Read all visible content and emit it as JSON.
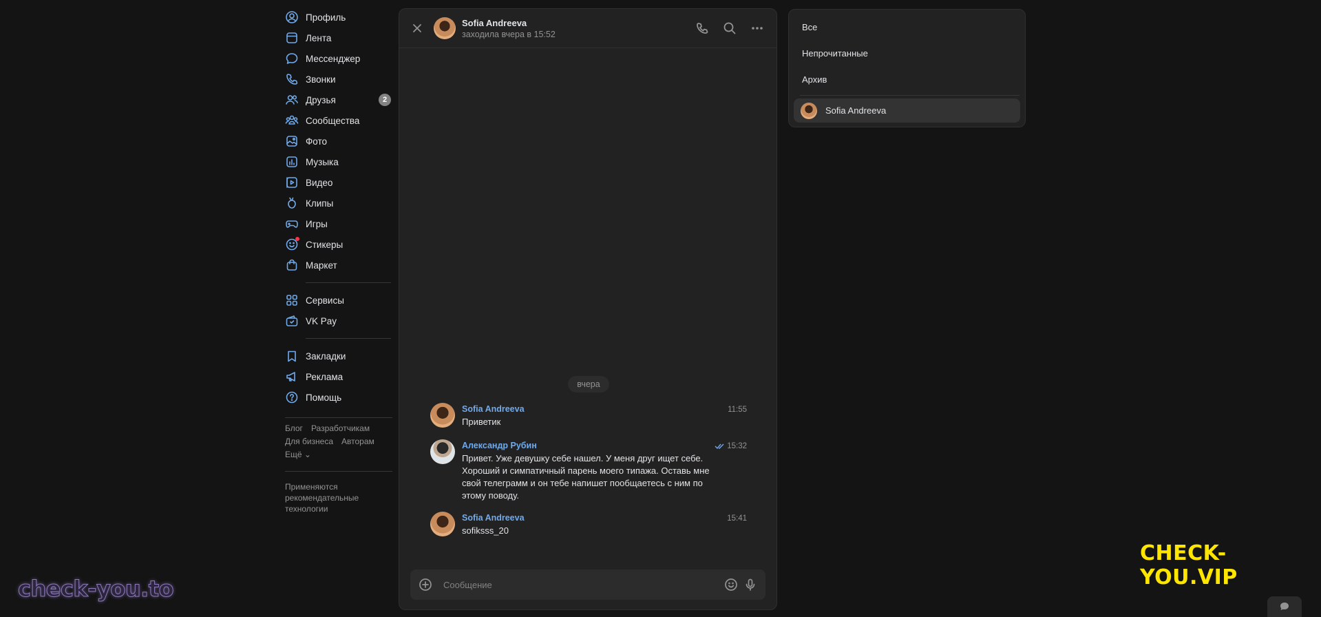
{
  "sidebar": {
    "items": [
      {
        "label": "Профиль",
        "icon": "user-circle-icon"
      },
      {
        "label": "Лента",
        "icon": "feed-icon"
      },
      {
        "label": "Мессенджер",
        "icon": "message-icon"
      },
      {
        "label": "Звонки",
        "icon": "phone-icon"
      },
      {
        "label": "Друзья",
        "icon": "users-icon",
        "badge": "2"
      },
      {
        "label": "Сообщества",
        "icon": "groups-icon"
      },
      {
        "label": "Фото",
        "icon": "photo-icon"
      },
      {
        "label": "Музыка",
        "icon": "music-icon"
      },
      {
        "label": "Видео",
        "icon": "video-icon"
      },
      {
        "label": "Клипы",
        "icon": "clips-icon"
      },
      {
        "label": "Игры",
        "icon": "gamepad-icon"
      },
      {
        "label": "Стикеры",
        "icon": "sticker-icon"
      },
      {
        "label": "Маркет",
        "icon": "bag-icon"
      },
      {
        "label": "Сервисы",
        "icon": "services-icon"
      },
      {
        "label": "VK Pay",
        "icon": "wallet-icon"
      },
      {
        "label": "Закладки",
        "icon": "bookmark-icon"
      },
      {
        "label": "Реклама",
        "icon": "megaphone-icon"
      },
      {
        "label": "Помощь",
        "icon": "help-icon"
      }
    ],
    "footer_links": [
      "Блог",
      "Разработчикам",
      "Для бизнеса",
      "Авторам",
      "Ещё ⌄"
    ],
    "recommendation_note": "Применяются рекомендательные технологии"
  },
  "chat": {
    "contact_name": "Sofia Andreeva",
    "contact_status": "заходила вчера в 15:52",
    "date_divider": "вчера",
    "messages": [
      {
        "author": "Sofia Andreeva",
        "text": "Приветик",
        "time": "11:55"
      },
      {
        "author": "Александр Рубин",
        "text": "Привет. Уже девушку себе нашел. У меня друг ищет себе. Хороший и симпатичный парень моего типажа. Оставь мне свой телеграмм и он тебе напишет пообщаетесь с ним по этому поводу.",
        "time": "15:32",
        "read": true
      },
      {
        "author": "Sofia Andreeva",
        "text": "sofiksss_20",
        "time": "15:41"
      }
    ],
    "composer_placeholder": "Сообщение"
  },
  "filters": {
    "items": [
      "Все",
      "Непрочитанные",
      "Архив"
    ],
    "conversations": [
      {
        "name": "Sofia Andreeva"
      }
    ]
  },
  "watermarks": {
    "left": "check-you.to",
    "right": "CHECK-YOU.VIP"
  },
  "colors": {
    "accent": "#71aaeb",
    "background": "#141414",
    "panel": "#222222",
    "badge": "#828282",
    "watermark_yellow": "#ffe600"
  }
}
